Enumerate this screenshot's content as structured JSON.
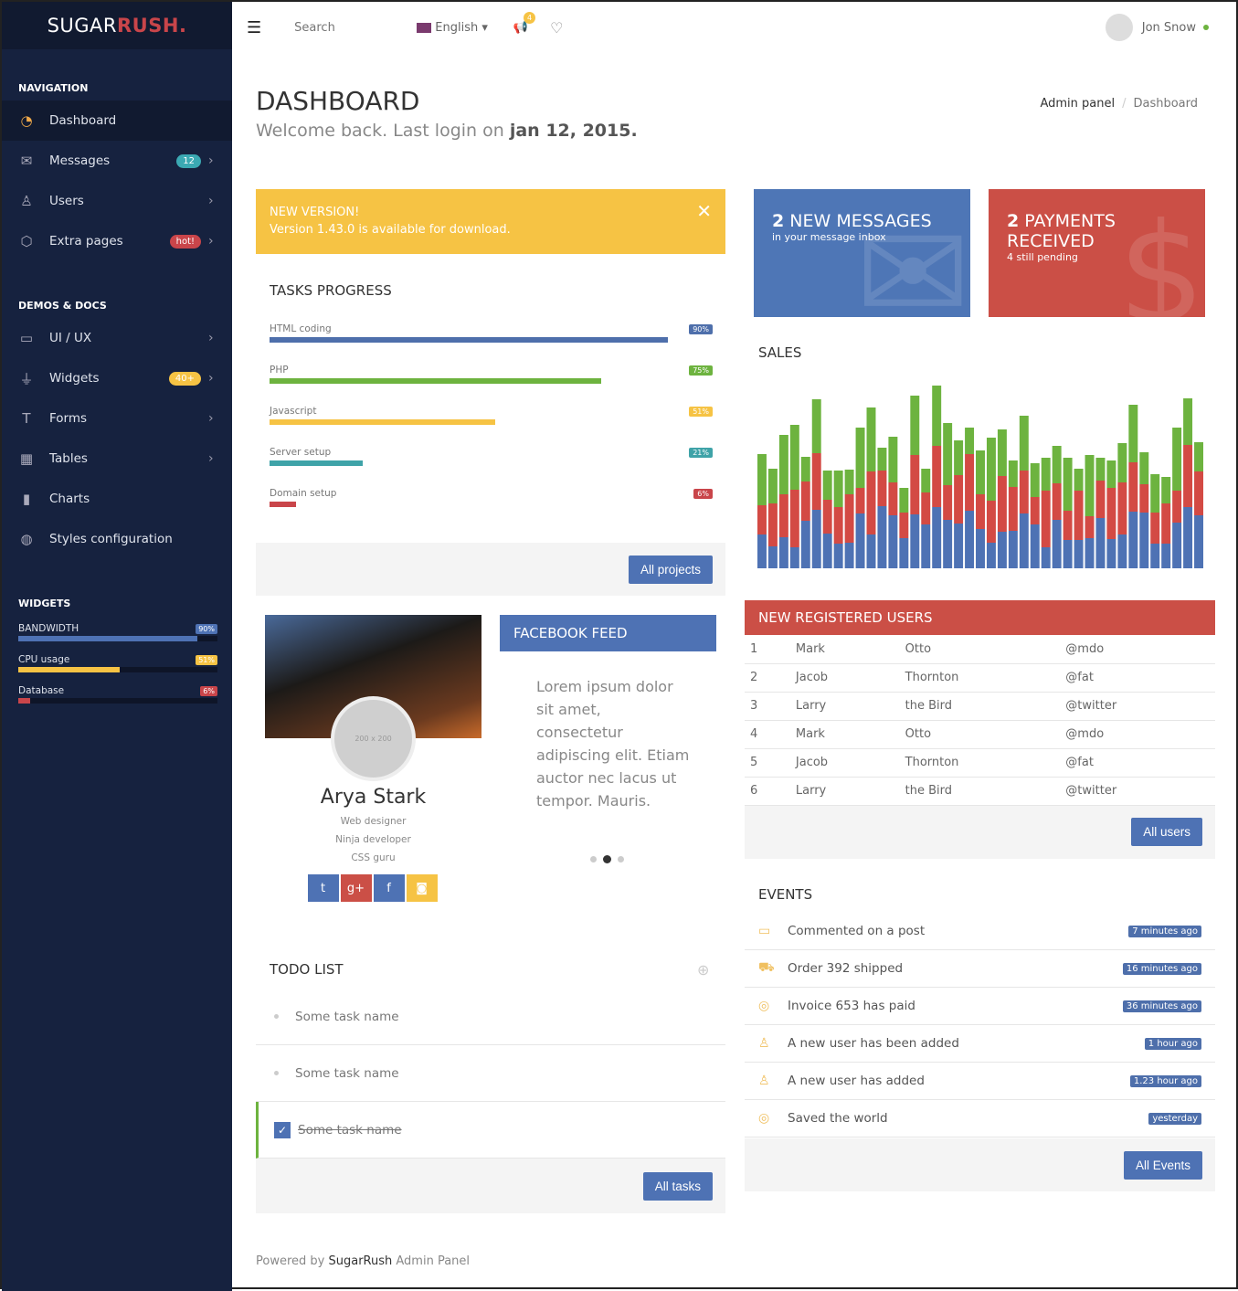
{
  "brand": {
    "part1": "SUGAR",
    "part2": "RUSH."
  },
  "topbar": {
    "search_placeholder": "Search",
    "language": "English",
    "notification_count": "4",
    "user_name": "Jon Snow"
  },
  "sidebar": {
    "nav_title": "NAVIGATION",
    "nav_items": [
      {
        "label": "Dashboard",
        "icon": "dashboard-icon"
      },
      {
        "label": "Messages",
        "icon": "envelope-icon",
        "badge": "12",
        "badge_color": "#3ba9b3"
      },
      {
        "label": "Users",
        "icon": "user-icon"
      },
      {
        "label": "Extra pages",
        "icon": "cube-icon",
        "badge": "hot!",
        "badge_color": "#c9454a"
      }
    ],
    "demos_title": "DEMOS & DOCS",
    "demo_items": [
      {
        "label": "UI / UX",
        "icon": "monitor-icon"
      },
      {
        "label": "Widgets",
        "icon": "plug-icon",
        "badge": "40+",
        "badge_color": "#f6c344"
      },
      {
        "label": "Forms",
        "icon": "text-icon"
      },
      {
        "label": "Tables",
        "icon": "grid-icon"
      },
      {
        "label": "Charts",
        "icon": "bar-chart-icon"
      },
      {
        "label": "Styles configuration",
        "icon": "palette-icon"
      }
    ],
    "widgets_title": "WIDGETS",
    "widgets": [
      {
        "label": "BANDWIDTH",
        "value": 90,
        "badge": "90%",
        "color": "#4e72b4"
      },
      {
        "label": "CPU usage",
        "value": 51,
        "badge": "51%",
        "color": "#f6c344"
      },
      {
        "label": "Database",
        "value": 6,
        "badge": "6%",
        "color": "#c9454a"
      }
    ]
  },
  "header": {
    "title": "DASHBOARD",
    "subtitle": "Welcome back. Last login on ",
    "last_login": "jan 12, 2015.",
    "breadcrumb": [
      "Admin panel",
      "Dashboard"
    ]
  },
  "alert": {
    "title": "NEW VERSION!",
    "message": "Version 1.43.0 is available for download."
  },
  "tasks": {
    "title": "TASKS PROGRESS",
    "button": "All projects",
    "items": [
      {
        "label": "HTML coding",
        "value": 90,
        "badge": "90%",
        "color": "#4e6fab"
      },
      {
        "label": "PHP",
        "value": 75,
        "badge": "75%",
        "color": "#6db33f"
      },
      {
        "label": "Javascript",
        "value": 51,
        "badge": "51%",
        "color": "#f6c344"
      },
      {
        "label": "Server setup",
        "value": 21,
        "badge": "21%",
        "color": "#3fa3a8"
      },
      {
        "label": "Domain setup",
        "value": 6,
        "badge": "6%",
        "color": "#c9454a"
      }
    ]
  },
  "stats": [
    {
      "count": "2",
      "label": "NEW MESSAGES",
      "sub": "in your message inbox",
      "color": "#4e76b6",
      "icon": "envelope-icon"
    },
    {
      "count": "2",
      "label": "PAYMENTS RECEIVED",
      "sub": "4 still pending",
      "color": "#cb4f46",
      "icon": "dollar-icon"
    }
  ],
  "sales": {
    "title": "SALES"
  },
  "chart_data": {
    "type": "bar",
    "stacked": true,
    "title": "SALES",
    "colors": [
      "#4e72b4",
      "#d34a44",
      "#6db33f"
    ],
    "series": [
      {
        "values": [
          37,
          24,
          34,
          23,
          52,
          64,
          38,
          27,
          28,
          60,
          37,
          68,
          58,
          33,
          59,
          48,
          67,
          53,
          49,
          63,
          43,
          28,
          40,
          41,
          60,
          48,
          23,
          53,
          31,
          31,
          33,
          55,
          32,
          37,
          62,
          61,
          27,
          27,
          50,
          67,
          58
        ]
      },
      {
        "values": [
          32,
          47,
          47,
          63,
          43,
          62,
          37,
          40,
          53,
          28,
          69,
          39,
          36,
          28,
          65,
          35,
          67,
          38,
          53,
          62,
          38,
          46,
          61,
          48,
          47,
          30,
          62,
          40,
          32,
          54,
          24,
          41,
          56,
          57,
          54,
          31,
          34,
          44,
          35,
          68,
          48
        ]
      },
      {
        "values": [
          56,
          38,
          65,
          71,
          27,
          59,
          32,
          40,
          27,
          66,
          70,
          25,
          50,
          27,
          65,
          26,
          66,
          68,
          38,
          29,
          48,
          69,
          51,
          29,
          60,
          37,
          36,
          41,
          58,
          24,
          67,
          25,
          30,
          43,
          63,
          35,
          42,
          29,
          69,
          51,
          32
        ]
      }
    ]
  },
  "profile": {
    "name": "Arya Stark",
    "placeholder": "200 x 200",
    "roles": [
      "Web designer",
      "Ninja developer",
      "CSS guru"
    ],
    "social": [
      "twitter-icon",
      "google-plus-icon",
      "facebook-icon",
      "instagram-icon"
    ]
  },
  "facebook": {
    "title": "FACEBOOK FEED",
    "text": "Lorem ipsum dolor sit amet, consectetur adipiscing elit. Etiam auctor nec lacus ut tempor. Mauris."
  },
  "users": {
    "title": "NEW REGISTERED USERS",
    "button": "All users",
    "rows": [
      [
        "1",
        "Mark",
        "Otto",
        "@mdo"
      ],
      [
        "2",
        "Jacob",
        "Thornton",
        "@fat"
      ],
      [
        "3",
        "Larry",
        "the Bird",
        "@twitter"
      ],
      [
        "4",
        "Mark",
        "Otto",
        "@mdo"
      ],
      [
        "5",
        "Jacob",
        "Thornton",
        "@fat"
      ],
      [
        "6",
        "Larry",
        "the Bird",
        "@twitter"
      ]
    ]
  },
  "events": {
    "title": "EVENTS",
    "button": "All Events",
    "items": [
      {
        "label": "Commented on a post",
        "time": "7 minutes ago",
        "icon": "comment-icon"
      },
      {
        "label": "Order 392 shipped",
        "time": "16 minutes ago",
        "icon": "truck-icon"
      },
      {
        "label": "Invoice 653 has paid",
        "time": "36 minutes ago",
        "icon": "globe-icon"
      },
      {
        "label": "A new user has been added",
        "time": "1 hour ago",
        "icon": "user-icon"
      },
      {
        "label": "A new user has added",
        "time": "1.23 hour ago",
        "icon": "user-icon"
      },
      {
        "label": "Saved the world",
        "time": "yesterday",
        "icon": "globe-icon"
      }
    ]
  },
  "todo": {
    "title": "TODO LIST",
    "button": "All tasks",
    "items": [
      {
        "label": "Some task name",
        "done": false
      },
      {
        "label": "Some task name",
        "done": false
      },
      {
        "label": "Some task name",
        "done": true
      }
    ]
  },
  "footer": {
    "prefix": "Powered by ",
    "brand": "SugarRush",
    "suffix": " Admin Panel"
  }
}
